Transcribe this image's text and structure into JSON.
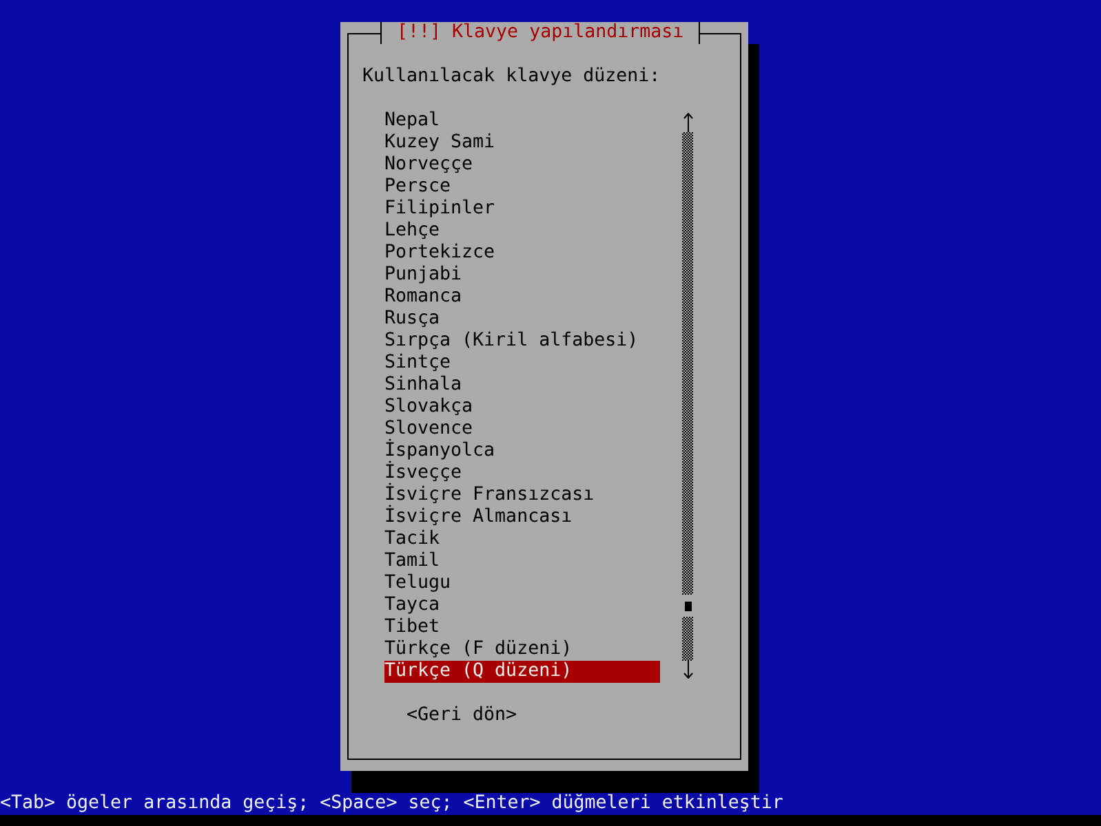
{
  "dialog": {
    "title": "[!!] Klavye yapılandırması",
    "prompt": "Kullanılacak klavye düzeni:",
    "list": {
      "items": [
        {
          "label": "Nepal",
          "selected": false
        },
        {
          "label": "Kuzey Sami",
          "selected": false
        },
        {
          "label": "Norveççe",
          "selected": false
        },
        {
          "label": "Persce",
          "selected": false
        },
        {
          "label": "Filipinler",
          "selected": false
        },
        {
          "label": "Lehçe",
          "selected": false
        },
        {
          "label": "Portekizce",
          "selected": false
        },
        {
          "label": "Punjabi",
          "selected": false
        },
        {
          "label": "Romanca",
          "selected": false
        },
        {
          "label": "Rusça",
          "selected": false
        },
        {
          "label": "Sırpça (Kiril alfabesi)",
          "selected": false
        },
        {
          "label": "Sintçe",
          "selected": false
        },
        {
          "label": "Sinhala",
          "selected": false
        },
        {
          "label": "Slovakça",
          "selected": false
        },
        {
          "label": "Slovence",
          "selected": false
        },
        {
          "label": "İspanyolca",
          "selected": false
        },
        {
          "label": "İsveççe",
          "selected": false
        },
        {
          "label": "İsviçre Fransızcası",
          "selected": false
        },
        {
          "label": "İsviçre Almancası",
          "selected": false
        },
        {
          "label": "Tacik",
          "selected": false
        },
        {
          "label": "Tamil",
          "selected": false
        },
        {
          "label": "Telugu",
          "selected": false
        },
        {
          "label": "Tayca",
          "selected": false
        },
        {
          "label": "Tibet",
          "selected": false
        },
        {
          "label": "Türkçe (F düzeni)",
          "selected": false
        },
        {
          "label": "Türkçe (Q düzeni)",
          "selected": true
        }
      ]
    },
    "buttons": [
      {
        "label": "<Geri dön>"
      }
    ]
  },
  "status_bar": "<Tab> ögeler arasında geçiş; <Space> seç; <Enter> düğmeleri etkinleştir"
}
